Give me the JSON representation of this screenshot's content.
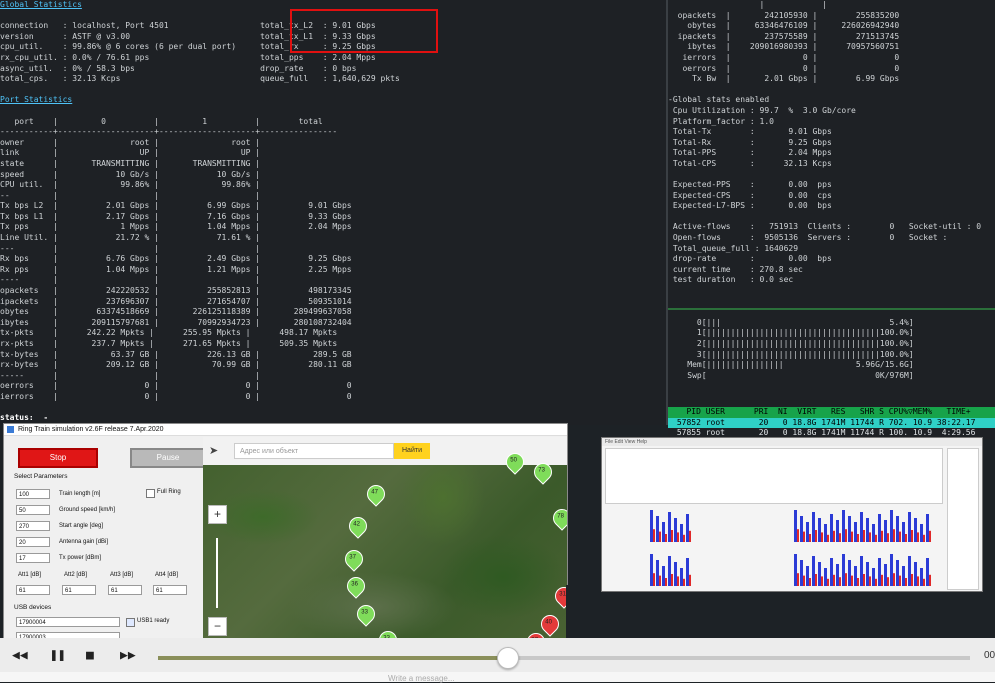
{
  "left_terminal": {
    "lines": [
      {
        "t": "Global Statistics",
        "cls": "u"
      },
      {
        "t": ""
      },
      {
        "t": "connection   : localhost, Port 4501                   total_tx_L2  : 9.01 Gbps"
      },
      {
        "t": "version      : ASTF @ v3.00                           total_tx_L1  : 9.33 Gbps"
      },
      {
        "t": "cpu_util.    : 99.86% @ 6 cores (6 per dual port)     total_rx     : 9.25 Gbps"
      },
      {
        "t": "rx_cpu_util. : 0.0% / 76.61 pps                       total_pps    : 2.04 Mpps"
      },
      {
        "t": "async_util.  : 0% / 58.3 bps                          drop_rate    : 0 bps"
      },
      {
        "t": "total_cps.   : 32.13 Kcps                             queue_full   : 1,640,629 pkts"
      },
      {
        "t": ""
      },
      {
        "t": "Port Statistics",
        "cls": "u"
      },
      {
        "t": ""
      },
      {
        "t": "   port    |         0          |         1          |        total"
      },
      {
        "t": "-----------+--------------------+--------------------+----------------"
      },
      {
        "t": "owner      |               root |               root |"
      },
      {
        "t": "link       |                 UP |                 UP |"
      },
      {
        "t": "state      |       TRANSMITTING |       TRANSMITTING |"
      },
      {
        "t": "speed      |            10 Gb/s |            10 Gb/s |"
      },
      {
        "t": "CPU util.  |             99.86% |             99.86% |"
      },
      {
        "t": "--         |                    |                    |"
      },
      {
        "t": "Tx bps L2  |          2.01 Gbps |          6.99 Gbps |          9.01 Gbps"
      },
      {
        "t": "Tx bps L1  |          2.17 Gbps |          7.16 Gbps |          9.33 Gbps"
      },
      {
        "t": "Tx pps     |             1 Mpps |          1.04 Mpps |          2.04 Mpps"
      },
      {
        "t": "Line Util. |            21.72 % |            71.61 % |"
      },
      {
        "t": "---        |                    |                    |"
      },
      {
        "t": "Rx bps     |          6.76 Gbps |          2.49 Gbps |          9.25 Gbps"
      },
      {
        "t": "Rx pps     |          1.04 Mpps |          1.21 Mpps |          2.25 Mpps"
      },
      {
        "t": "----       |                    |                    |"
      },
      {
        "t": "opackets   |          242220532 |          255852813 |          498173345"
      },
      {
        "t": "ipackets   |          237696307 |          271654707 |          509351014"
      },
      {
        "t": "obytes     |        63374518669 |       226125118389 |       289499637058"
      },
      {
        "t": "ibytes     |       209115797681 |        70992934723 |       280108732404"
      },
      {
        "t": "tx-pkts    |      242.22 Mpkts |      255.95 Mpkts |      498.17 Mpkts"
      },
      {
        "t": "rx-pkts    |       237.7 Mpkts |      271.65 Mpkts |      509.35 Mpkts"
      },
      {
        "t": "tx-bytes   |           63.37 GB |          226.13 GB |           289.5 GB"
      },
      {
        "t": "rx-bytes   |          209.12 GB |           70.99 GB |          280.11 GB"
      },
      {
        "t": "-----      |                    |                    |"
      },
      {
        "t": "oerrors    |                  0 |                  0 |                  0"
      },
      {
        "t": "ierrors    |                  0 |                  0 |                  0"
      },
      {
        "t": ""
      },
      {
        "t": "status:  -",
        "cls": "w"
      }
    ]
  },
  "right_terminal": {
    "lines": [
      {
        "t": "                   |            |"
      },
      {
        "t": "  opackets  |       242105930 |        255835200"
      },
      {
        "t": "    obytes  |     63346476109 |     226026942940"
      },
      {
        "t": "  ipackets  |       237575589 |        271513745"
      },
      {
        "t": "    ibytes  |    209016980393 |      70957560751"
      },
      {
        "t": "   ierrors  |               0 |                0"
      },
      {
        "t": "   oerrors  |               0 |                0"
      },
      {
        "t": "     Tx Bw  |       2.01 Gbps |        6.99 Gbps"
      },
      {
        "t": ""
      },
      {
        "t": "-Global stats enabled"
      },
      {
        "t": " Cpu Utilization : 99.7  %  3.0 Gb/core"
      },
      {
        "t": " Platform_factor : 1.0"
      },
      {
        "t": " Total-Tx        :       9.01 Gbps"
      },
      {
        "t": " Total-Rx        :       9.25 Gbps"
      },
      {
        "t": " Total-PPS       :       2.04 Mpps"
      },
      {
        "t": " Total-CPS       :      32.13 Kcps"
      },
      {
        "t": ""
      },
      {
        "t": " Expected-PPS    :       0.00  pps"
      },
      {
        "t": " Expected-CPS    :       0.00  cps"
      },
      {
        "t": " Expected-L7-BPS :       0.00  bps"
      },
      {
        "t": ""
      },
      {
        "t": " Active-flows    :   751913  Clients :        0   Socket-util : 0"
      },
      {
        "t": " Open-flows      :  9505136  Servers :        0   Socket :"
      },
      {
        "t": " Total_queue_full : 1640629"
      },
      {
        "t": " drop-rate       :       0.00  bps"
      },
      {
        "t": " current time    : 270.8 sec"
      },
      {
        "t": " test duration   : 0.0 sec"
      },
      {
        "t": ""
      },
      {
        "t": ""
      },
      {
        "t": ""
      },
      {
        "t": "      0[|||                                   5.4%]"
      },
      {
        "t": "      1[||||||||||||||||||||||||||||||||||||100.0%]"
      },
      {
        "t": "      2[||||||||||||||||||||||||||||||||||||100.0%]"
      },
      {
        "t": "      3[||||||||||||||||||||||||||||||||||||100.0%]"
      },
      {
        "t": "    Mem[||||||||||||||||               5.96G/15.6G]"
      },
      {
        "t": "    Swp[                                   0K/976M]"
      }
    ]
  },
  "htop": {
    "header": "   PID USER      PRI  NI  VIRT   RES   SHR S CPU%▽MEM%   TIME+",
    "row1": " 57852 root       20   0 18.8G 1741M 11744 R 702. 10.9 38:22.17",
    "row2": " 57855 root       20   0 18.8G 1741M 11744 R 100. 10.9  4:29.56"
  },
  "ring_sim": {
    "title": "Ring Train simulation v2.6F release 7.Apr.2020",
    "stop_label": "Stop",
    "pause_label": "Pause",
    "select_params": "Select Parameters",
    "fields": [
      {
        "value": "100",
        "label": "Train length [m]"
      },
      {
        "value": "50",
        "label": "Ground speed [km/h]"
      },
      {
        "value": "270",
        "label": "Start angle [deg]"
      },
      {
        "value": "20",
        "label": "Antenna gain [dBi]"
      },
      {
        "value": "17",
        "label": "Tx power [dBm]"
      }
    ],
    "full_ring": "Full Ring",
    "att_labels": [
      "Att1 [dB]",
      "Att2 [dB]",
      "Att3 [dB]",
      "Att4 [dB]"
    ],
    "att_values": [
      "61",
      "61",
      "61",
      "61"
    ],
    "usb_devices": "USB devices",
    "usb1_value": "17900004",
    "usb1_label": "USB1 ready",
    "usb2_value": "17900003",
    "map_search_placeholder": "Адрес или объект",
    "map_find": "Найти",
    "markers": [
      "50",
      "73",
      "47",
      "42",
      "78",
      "37",
      "36",
      "33",
      "40",
      "37",
      "33",
      "31"
    ]
  },
  "chart_window": {
    "toolbar": "File  Edit  View  Help"
  },
  "media": {
    "progress": 0.43,
    "time": "00"
  },
  "message_bar": {
    "placeholder": "Write a message..."
  }
}
